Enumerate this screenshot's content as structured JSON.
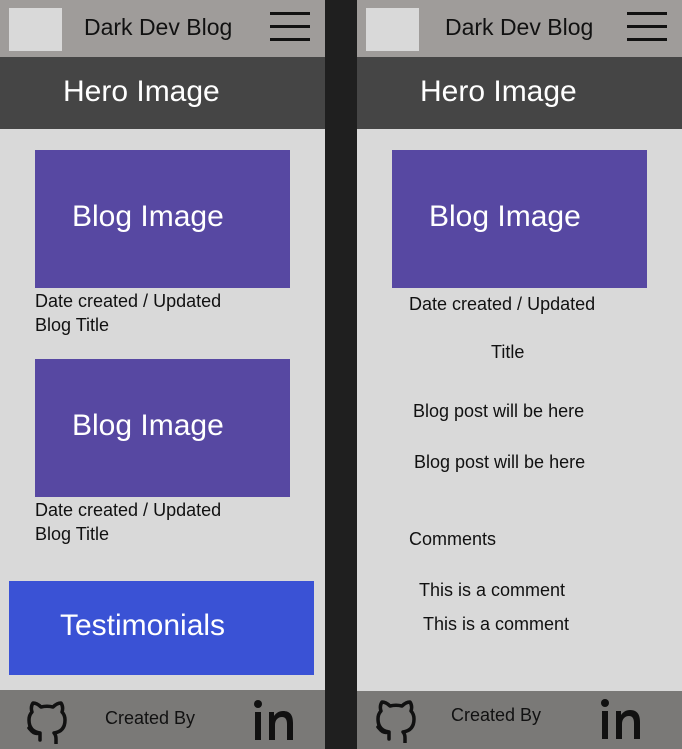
{
  "header": {
    "title": "Dark Dev Blog"
  },
  "hero": {
    "label": "Hero Image"
  },
  "list_view": {
    "posts": [
      {
        "image_label": "Blog Image",
        "date_text": "Date created / Updated",
        "title": "Blog Title"
      },
      {
        "image_label": "Blog Image",
        "date_text": "Date created / Updated",
        "title": "Blog Title"
      }
    ],
    "testimonials_label": "Testimonials"
  },
  "detail_view": {
    "image_label": "Blog Image",
    "date_text": "Date created / Updated",
    "title": "Title",
    "body": [
      "Blog post will be here",
      "Blog post will be here"
    ],
    "comments_heading": "Comments",
    "comments": [
      "This is a comment",
      "This is a comment"
    ]
  },
  "footer": {
    "created_by": "Created By",
    "icons": [
      "github-icon",
      "linkedin-icon"
    ]
  },
  "colors": {
    "page_background": "#1f1f1f",
    "frame_background": "#d9d9d9",
    "topbar": "#9f9c9a",
    "hero": "#454545",
    "blog_image": "#5748a2",
    "testimonials": "#3a52d5",
    "footer": "#7a7977"
  }
}
